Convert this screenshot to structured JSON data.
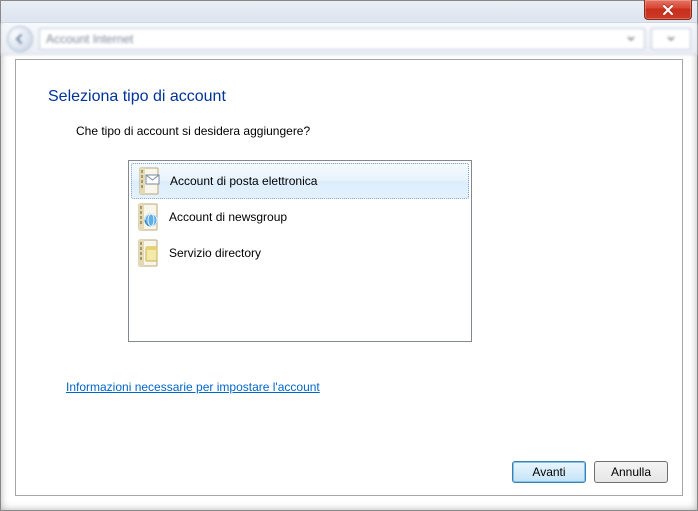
{
  "navbar": {
    "breadcrumb": "Account Internet"
  },
  "wizard": {
    "heading": "Seleziona tipo di account",
    "subheading": "Che tipo di account si desidera aggiungere?",
    "options": [
      {
        "label": "Account di posta elettronica",
        "icon": "mail",
        "selected": true
      },
      {
        "label": "Account di newsgroup",
        "icon": "newsgroup",
        "selected": false
      },
      {
        "label": "Servizio directory",
        "icon": "directory",
        "selected": false
      }
    ],
    "help_link": "Informazioni necessarie per impostare l'account"
  },
  "buttons": {
    "next": "Avanti",
    "cancel": "Annulla"
  }
}
